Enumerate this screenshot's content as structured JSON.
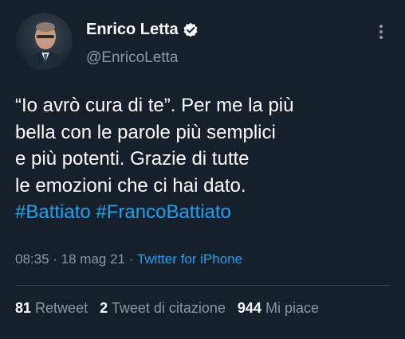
{
  "author": {
    "display_name": "Enrico Letta",
    "handle": "@EnricoLetta",
    "verified": true
  },
  "tweet": {
    "lines": [
      "“Io avrò cura di te”. Per me la più",
      "bella con le parole più semplici",
      "e più potenti. Grazie di tutte",
      "le emozioni che ci hai dato."
    ],
    "hashtags": [
      "#Battiato",
      "#FrancoBattiato"
    ]
  },
  "meta": {
    "time": "08:35",
    "sep1": " · ",
    "date": "18 mag 21",
    "sep2": " · ",
    "source": "Twitter for iPhone"
  },
  "stats": {
    "retweets": {
      "count": "81",
      "label": "Retweet"
    },
    "quotes": {
      "count": "2",
      "label": "Tweet di citazione"
    },
    "likes": {
      "count": "944",
      "label": "Mi piace"
    }
  },
  "colors": {
    "background": "#15202b",
    "accent": "#1da1f2",
    "secondary_text": "#8899a6",
    "divider": "#38444d"
  },
  "icons": [
    "avatar",
    "verified-badge-icon",
    "more-options-icon"
  ]
}
